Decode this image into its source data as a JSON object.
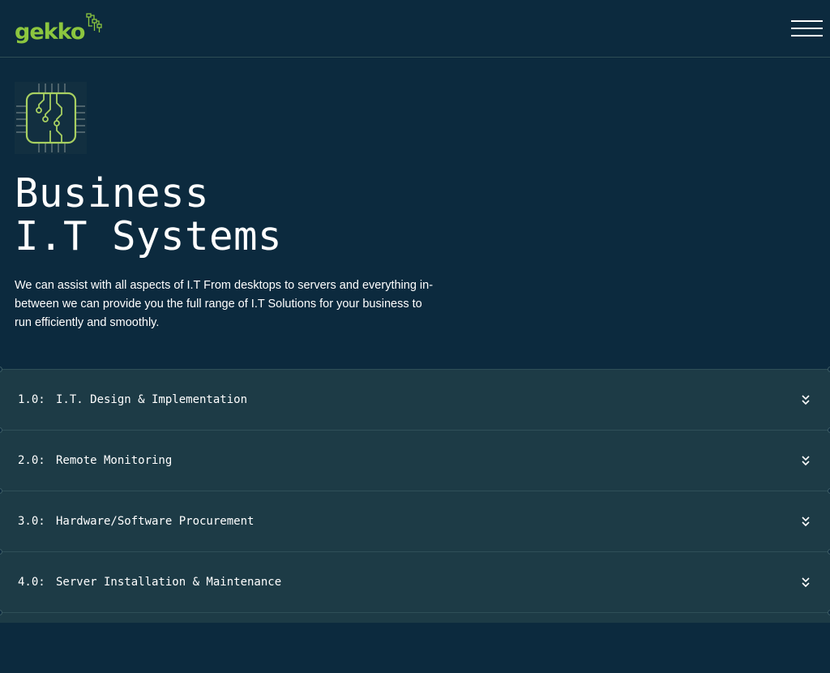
{
  "header": {
    "logo_text": "gekko",
    "menu_icon": "hamburger-menu-icon"
  },
  "hero": {
    "icon": "circuit-chip-icon",
    "title_line1": "Business",
    "title_line2": "I.T Systems",
    "description": "We can assist with all aspects of I.T From desktops to servers and everything in-between we can provide you the full range of I.T Solutions for your business to run efficiently and smoothly."
  },
  "services": [
    {
      "number": "1.0:",
      "label": "I.T. Design & Implementation",
      "icon": "double-chevron-down-icon"
    },
    {
      "number": "2.0:",
      "label": "Remote Monitoring",
      "icon": "double-chevron-down-icon"
    },
    {
      "number": "3.0:",
      "label": "Hardware/Software Procurement",
      "icon": "double-chevron-down-icon"
    },
    {
      "number": "4.0:",
      "label": "Server Installation & Maintenance",
      "icon": "double-chevron-down-icon"
    }
  ],
  "colors": {
    "background": "#0c2a3e",
    "accent": "#8cc63f",
    "services_bg": "#1d3b46",
    "text": "#ffffff"
  }
}
